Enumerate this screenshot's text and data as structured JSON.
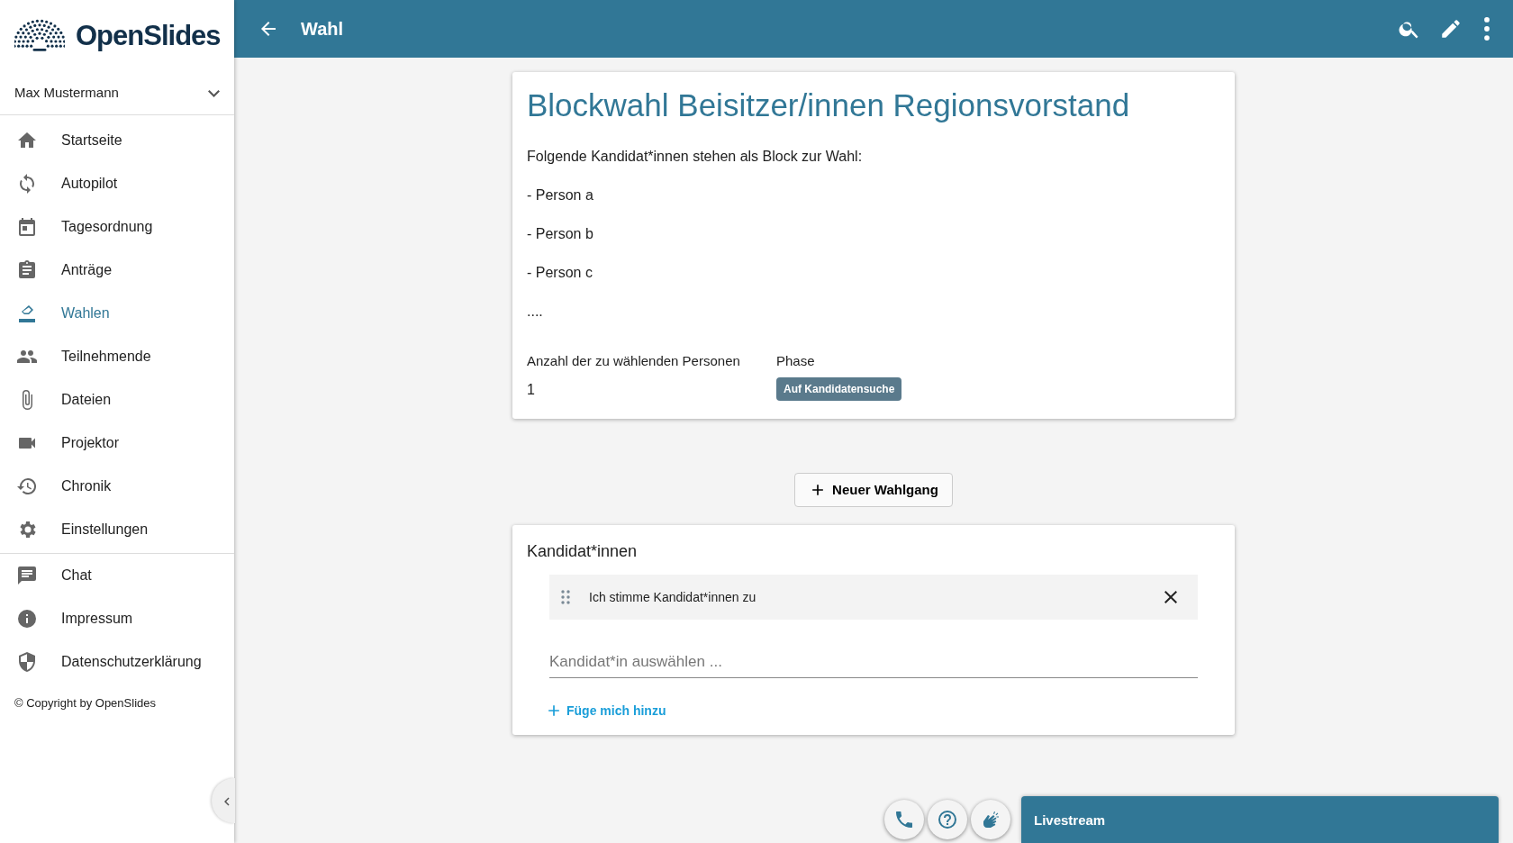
{
  "sidebar": {
    "logo_text": "OpenSlides",
    "user": "Max Mustermann",
    "items": [
      {
        "label": "Startseite",
        "selected": false
      },
      {
        "label": "Autopilot",
        "selected": false
      },
      {
        "label": "Tagesordnung",
        "selected": false
      },
      {
        "label": "Anträge",
        "selected": false
      },
      {
        "label": "Wahlen",
        "selected": true
      },
      {
        "label": "Teilnehmende",
        "selected": false
      },
      {
        "label": "Dateien",
        "selected": false
      },
      {
        "label": "Projektor",
        "selected": false
      },
      {
        "label": "Chronik",
        "selected": false
      },
      {
        "label": "Einstellungen",
        "selected": false
      }
    ],
    "footer_items": [
      {
        "label": "Chat"
      },
      {
        "label": "Impressum"
      },
      {
        "label": "Datenschutzerklärung"
      }
    ],
    "copyright": "© Copyright by OpenSlides"
  },
  "header": {
    "title": "Wahl"
  },
  "election": {
    "title": "Blockwahl Beisitzer/innen Regionsvorstand",
    "description": [
      "Folgende Kandidat*innen stehen als Block zur Wahl:",
      "- Person a",
      "- Person b",
      "- Person c",
      "...."
    ],
    "fields": [
      {
        "label": "Anzahl der zu wählenden Personen",
        "value": "1",
        "kind": "text"
      },
      {
        "label": "Phase",
        "value": "Auf Kandidatensuche",
        "kind": "badge"
      }
    ]
  },
  "new_ballot_button": "Neuer Wahlgang",
  "candidates": {
    "title": "Kandidat*innen",
    "items": [
      {
        "name": "Ich stimme Kandidat*innen zu"
      }
    ],
    "select": {
      "placeholder": "Kandidat*in auswählen ..."
    },
    "add_me": "Füge mich hinzu"
  },
  "livestream": {
    "title": "Livestream"
  }
}
